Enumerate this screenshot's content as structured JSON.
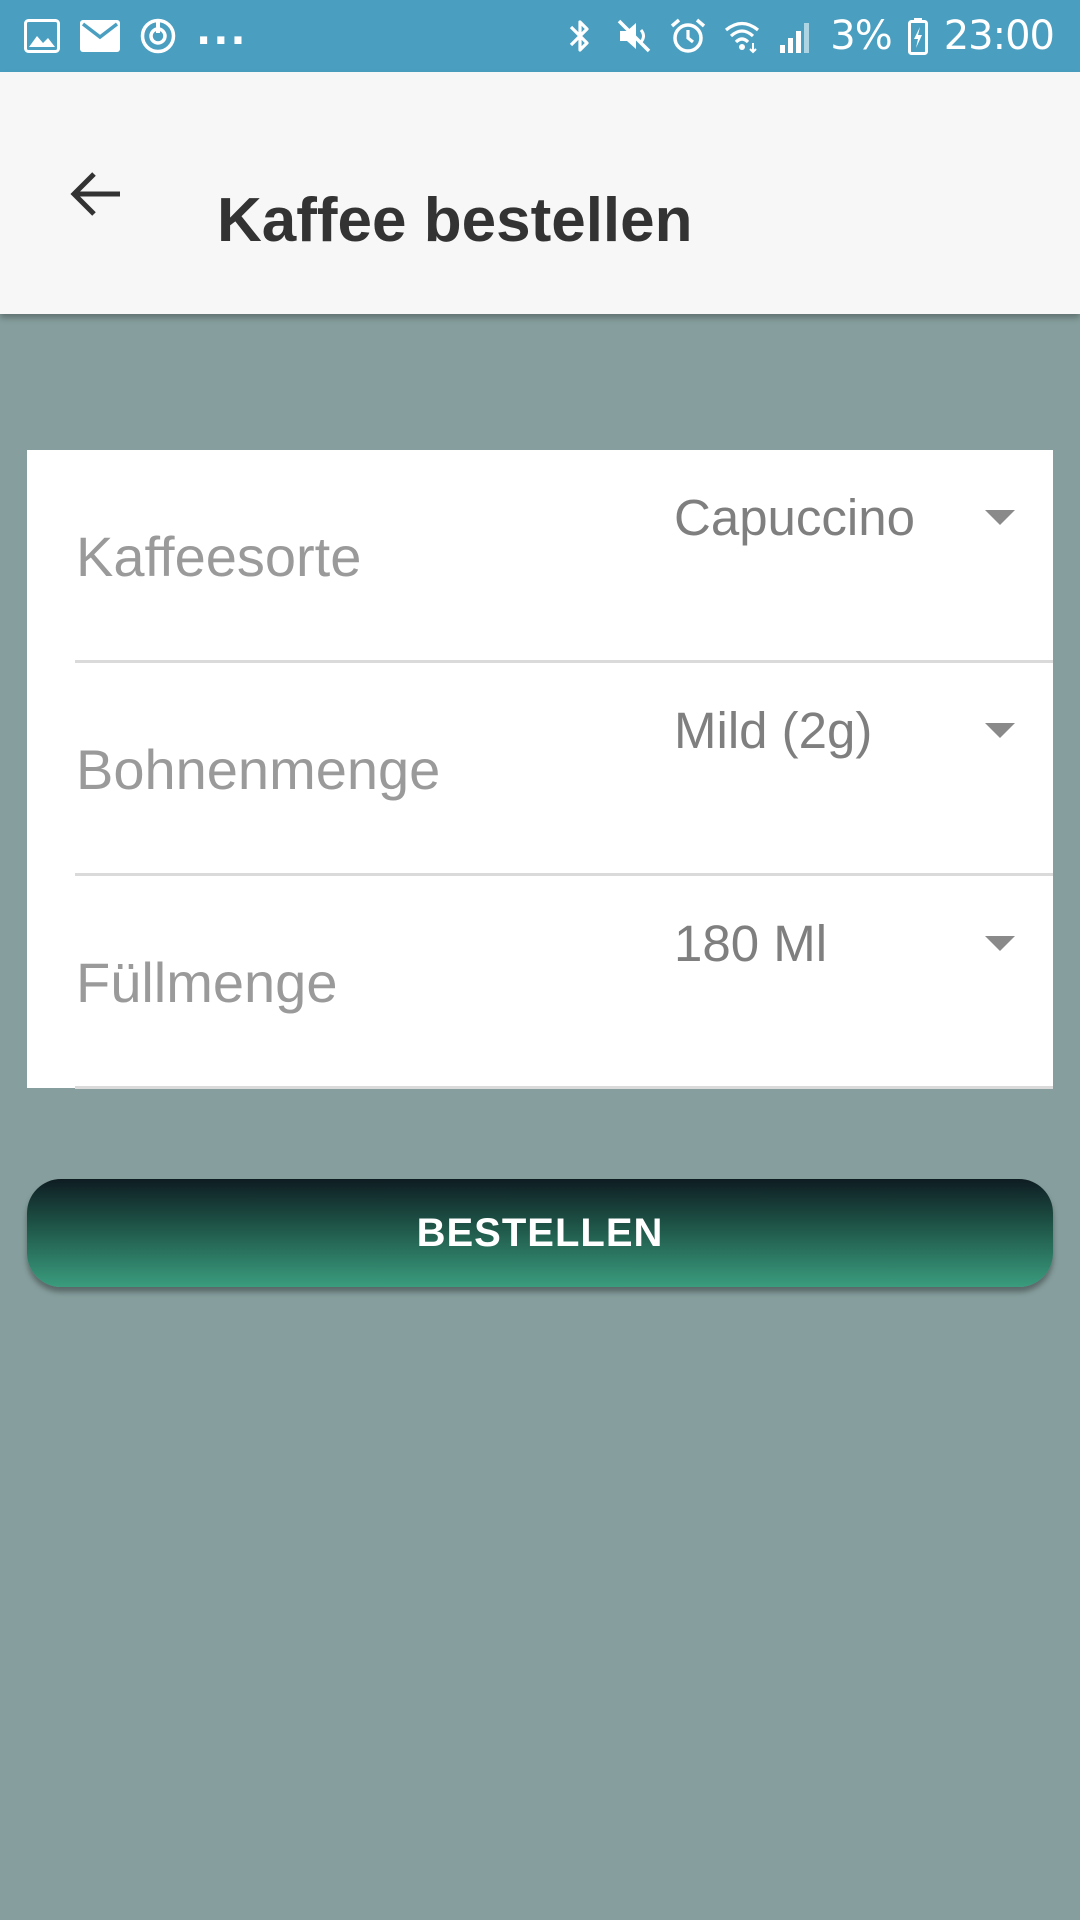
{
  "status_bar": {
    "left_icons": [
      "gallery-icon",
      "email-icon",
      "sync-icon"
    ],
    "overflow": "...",
    "right_icons": [
      "bluetooth-icon",
      "mute-icon",
      "alarm-icon",
      "wifi-icon",
      "signal-icon"
    ],
    "battery_percent": "3%",
    "time": "23:00",
    "color": "#4a9fc1"
  },
  "app_bar": {
    "back_icon": "arrow-left-icon",
    "title": "Kaffee bestellen"
  },
  "form": {
    "rows": [
      {
        "label": "Kaffeesorte",
        "value": "Capuccino"
      },
      {
        "label": "Bohnenmenge",
        "value": "Mild (2g)"
      },
      {
        "label": "Füllmenge",
        "value": "180 Ml"
      }
    ]
  },
  "order_button": {
    "label": "BESTELLEN"
  },
  "colors": {
    "background": "#869f9e",
    "button_gradient_top": "#0e1c22",
    "button_gradient_bottom": "#3a9c7d"
  }
}
